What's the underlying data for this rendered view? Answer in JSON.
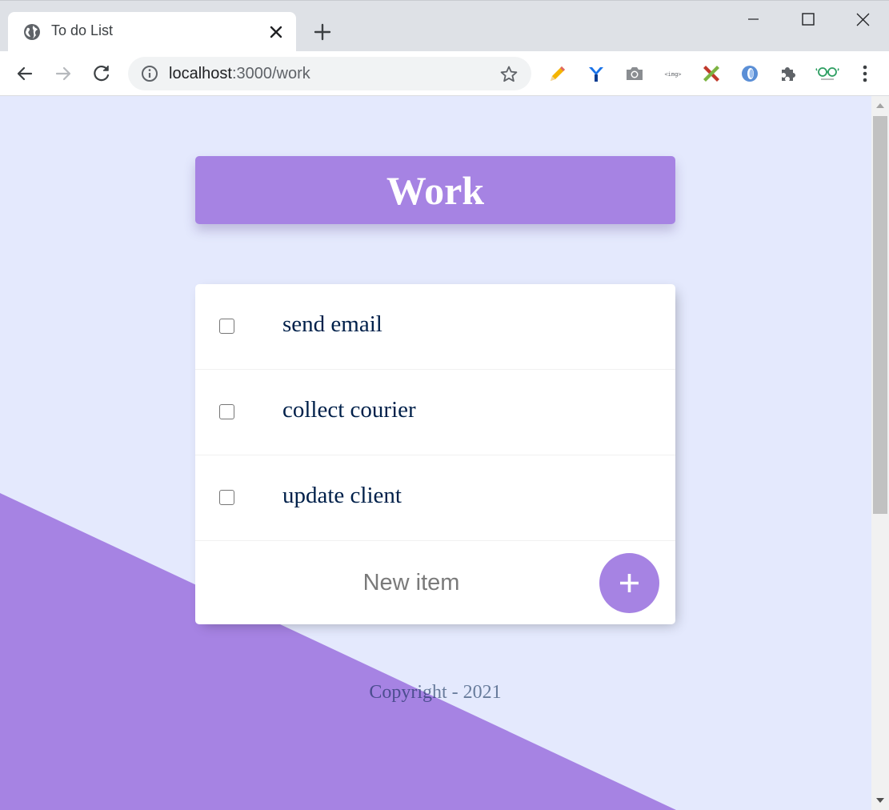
{
  "browser": {
    "tab_title": "To do List",
    "url_host": "localhost",
    "url_path": ":3000/work",
    "extensions": [
      "pencil-icon",
      "y-logo-icon",
      "camera-icon",
      "img-tag-icon",
      "ruler-cross-icon",
      "blue-ring-icon",
      "puzzle-icon",
      "glasses-icon"
    ]
  },
  "page": {
    "heading": "Work",
    "items": [
      {
        "label": "send email",
        "checked": false
      },
      {
        "label": "collect courier",
        "checked": false
      },
      {
        "label": "update client",
        "checked": false
      }
    ],
    "new_item_placeholder": "New item",
    "add_button_label": "+",
    "footer": "Copyright - 2021"
  },
  "colors": {
    "accent": "#a683e3",
    "page_background": "#e4e9fd",
    "text": "#00204a"
  }
}
